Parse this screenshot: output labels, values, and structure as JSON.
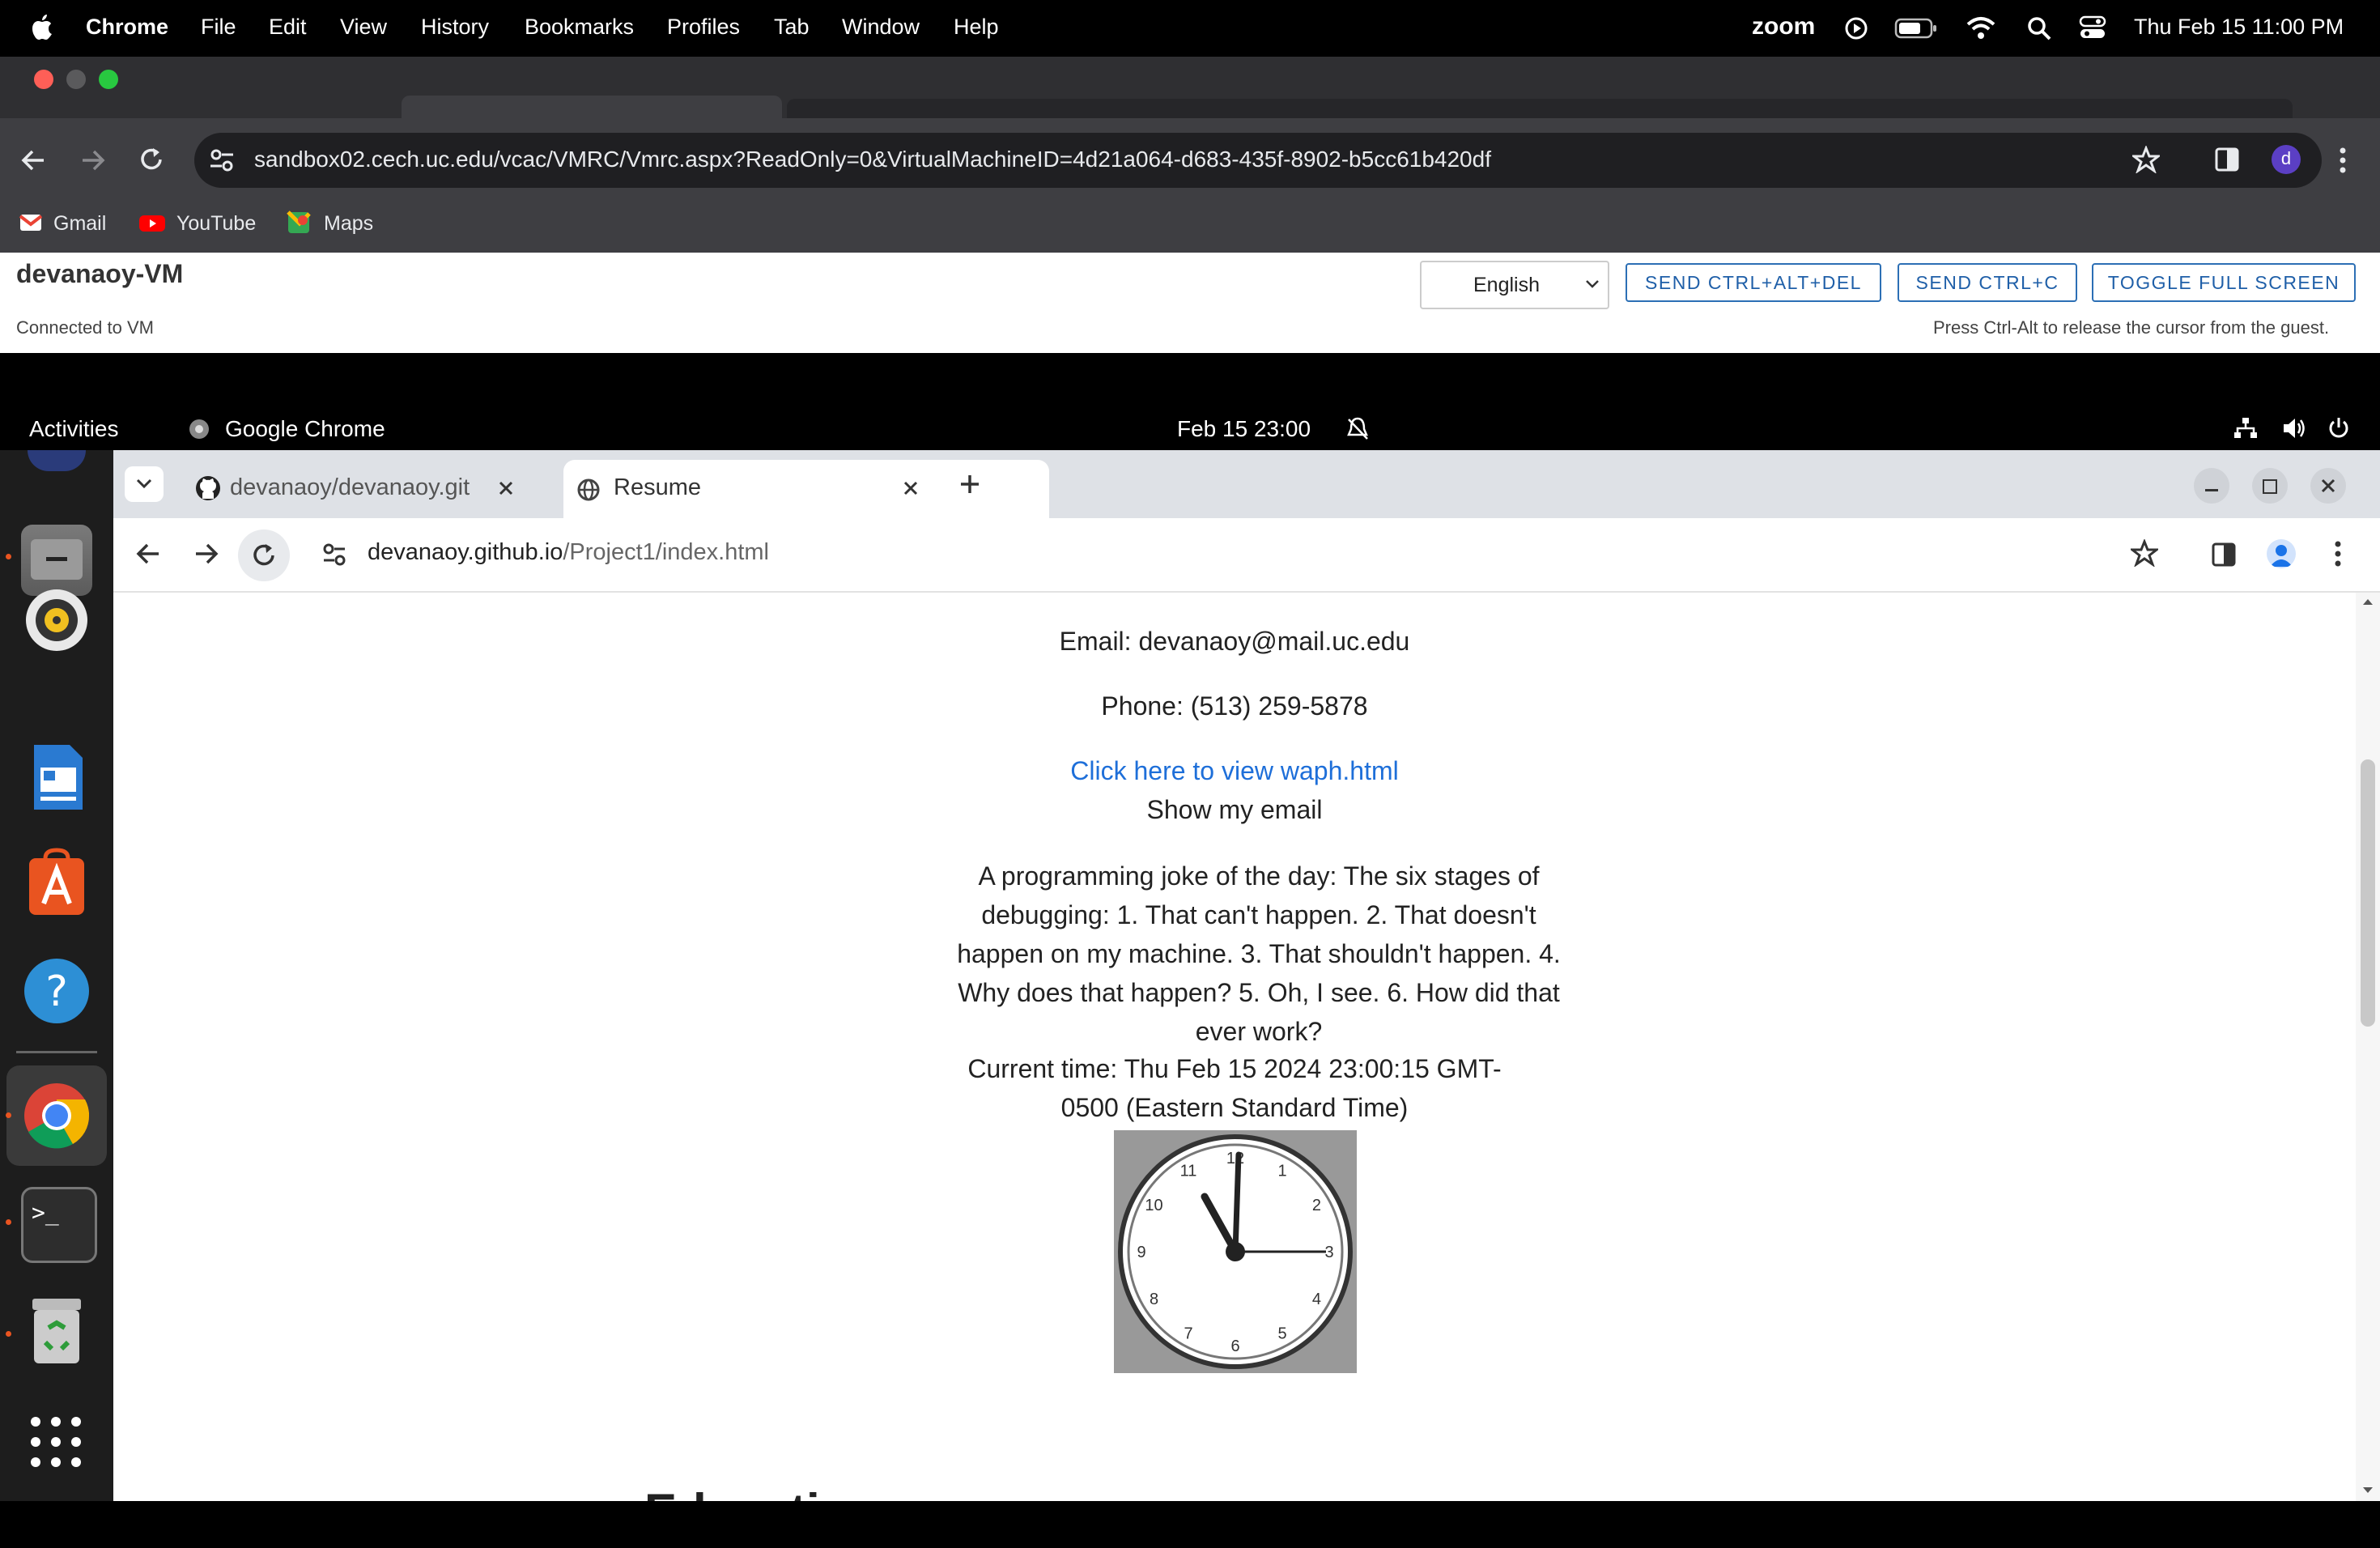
{
  "mac_menu": {
    "app": "Chrome",
    "items": [
      "File",
      "Edit",
      "View",
      "History",
      "Bookmarks",
      "Profiles",
      "Tab",
      "Window",
      "Help"
    ],
    "status": {
      "zoom": "zoom",
      "datetime": "Thu Feb 15  11:00 PM"
    }
  },
  "outer_browser": {
    "url": "sandbox02.cech.uc.edu/vcac/VMRC/Vmrc.aspx?ReadOnly=0&VirtualMachineID=4d21a064-d683-435f-8902-b5cc61b420df",
    "profile_initial": "d",
    "bookmarks": [
      "Gmail",
      "YouTube",
      "Maps"
    ]
  },
  "vmrc": {
    "vm_name": "devanaoy-VM",
    "status": "Connected to VM",
    "language": "English",
    "btn_cad": "SEND CTRL+ALT+DEL",
    "btn_ctrlc": "SEND CTRL+C",
    "btn_fullscreen": "TOGGLE FULL SCREEN",
    "hint": "Press Ctrl-Alt to release the cursor from the guest."
  },
  "gnome": {
    "activities": "Activities",
    "app": "Google Chrome",
    "clock": "Feb 15  23:00"
  },
  "inner_browser": {
    "tab1": "devanaoy/devanaoy.git",
    "tab2": "Resume",
    "url_host": "devanaoy.github.io",
    "url_path": "/Project1/index.html"
  },
  "page": {
    "email": "Email: devanaoy@mail.uc.edu",
    "phone": "Phone: (513) 259-5878",
    "link": "Click here to view waph.html",
    "show_email": "Show my email",
    "joke": "A programming joke of the day: The six stages of debugging: 1. That can't happen. 2. That doesn't happen on my machine. 3. That shouldn't happen. 4. Why does that happen? 5. Oh, I see. 6. How did that ever work?",
    "time_line1": "Current time: Thu Feb 15 2024 23:00:15 GMT-",
    "time_line2": "0500 (Eastern Standard Time)",
    "clock_numbers": [
      "12",
      "1",
      "2",
      "3",
      "4",
      "5",
      "6",
      "7",
      "8",
      "9",
      "10",
      "11"
    ],
    "partial_heading": "Educati"
  }
}
